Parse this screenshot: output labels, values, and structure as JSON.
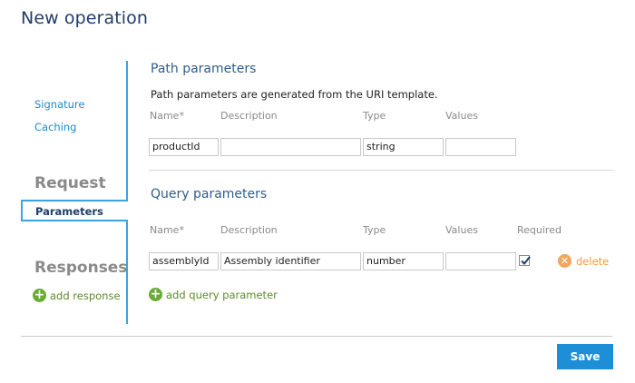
{
  "page": {
    "title": "New operation"
  },
  "sidebar": {
    "links": {
      "signature": "Signature",
      "caching": "Caching"
    },
    "request_heading": "Request",
    "selected_item": "Parameters",
    "responses_heading": "Responses",
    "add_response": "add response"
  },
  "path_params": {
    "title": "Path parameters",
    "hint": "Path parameters are generated from the URI template.",
    "columns": {
      "name": "Name*",
      "description": "Description",
      "type": "Type",
      "values": "Values"
    },
    "rows": [
      {
        "name": "productId",
        "description": "",
        "type": "string",
        "values": ""
      }
    ]
  },
  "query_params": {
    "title": "Query parameters",
    "columns": {
      "name": "Name*",
      "description": "Description",
      "type": "Type",
      "values": "Values",
      "required": "Required"
    },
    "rows": [
      {
        "name": "assemblyId",
        "description": "Assembly identifier",
        "type": "number",
        "values": "",
        "required": true,
        "delete_label": "delete"
      }
    ],
    "add_label": "add query parameter"
  },
  "actions": {
    "save": "Save"
  },
  "colors": {
    "accent": "#1e8fd6",
    "add": "#6aab33",
    "delete": "#f5a65b",
    "heading": "#1f3d66"
  }
}
